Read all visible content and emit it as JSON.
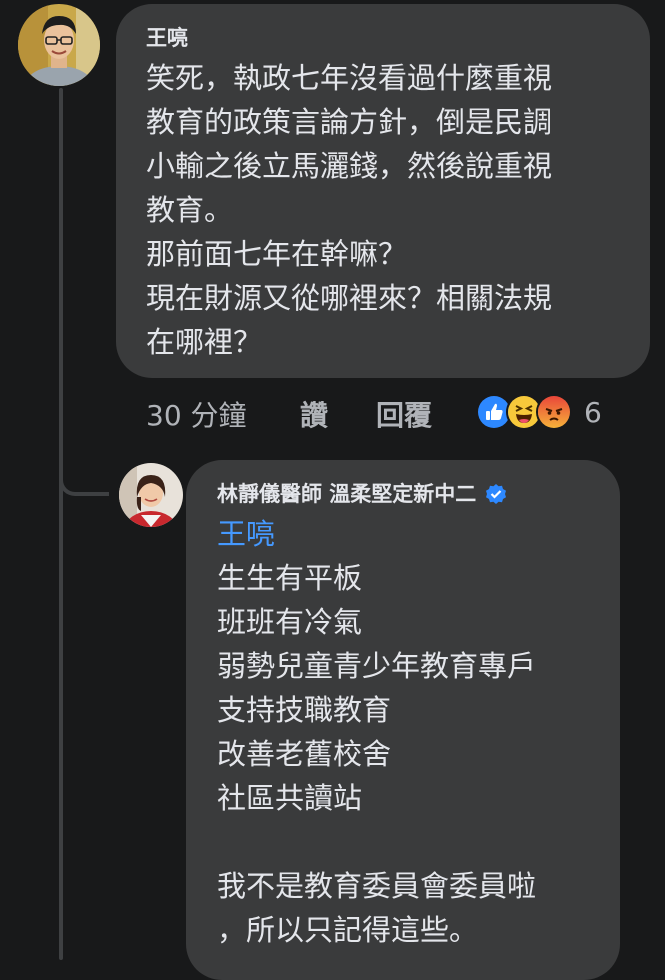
{
  "comment": {
    "author": "王喨",
    "lines": [
      "笑死，執政七年沒看過什麼重視",
      "教育的政策言論方針，倒是民調",
      "小輸之後立馬灑錢，然後說重視",
      "教育。",
      "那前面七年在幹嘛？",
      "現在財源又從哪裡來？相關法規",
      "在哪裡？"
    ],
    "timestamp": "30 分鐘",
    "like_label": "讚",
    "reply_label": "回覆",
    "reactions": [
      "like-icon",
      "haha-icon",
      "angry-icon"
    ],
    "reaction_count": "6"
  },
  "reply": {
    "author": "林靜儀醫師 溫柔堅定新中二",
    "verified": true,
    "mention": "王喨",
    "lines": [
      "生生有平板",
      "班班有冷氣",
      "弱勢兒童青少年教育專戶",
      "支持技職教育",
      "改善老舊校舍",
      "社區共讀站"
    ],
    "closing_lines": [
      "我不是教育委員會委員啦",
      "，所以只記得這些。"
    ]
  },
  "colors": {
    "background": "#18191a",
    "bubble": "#3a3b3c",
    "text": "#e4e6eb",
    "secondary_text": "#b0b3b8",
    "mention": "#4599ff",
    "verified": "#2d88ff"
  }
}
